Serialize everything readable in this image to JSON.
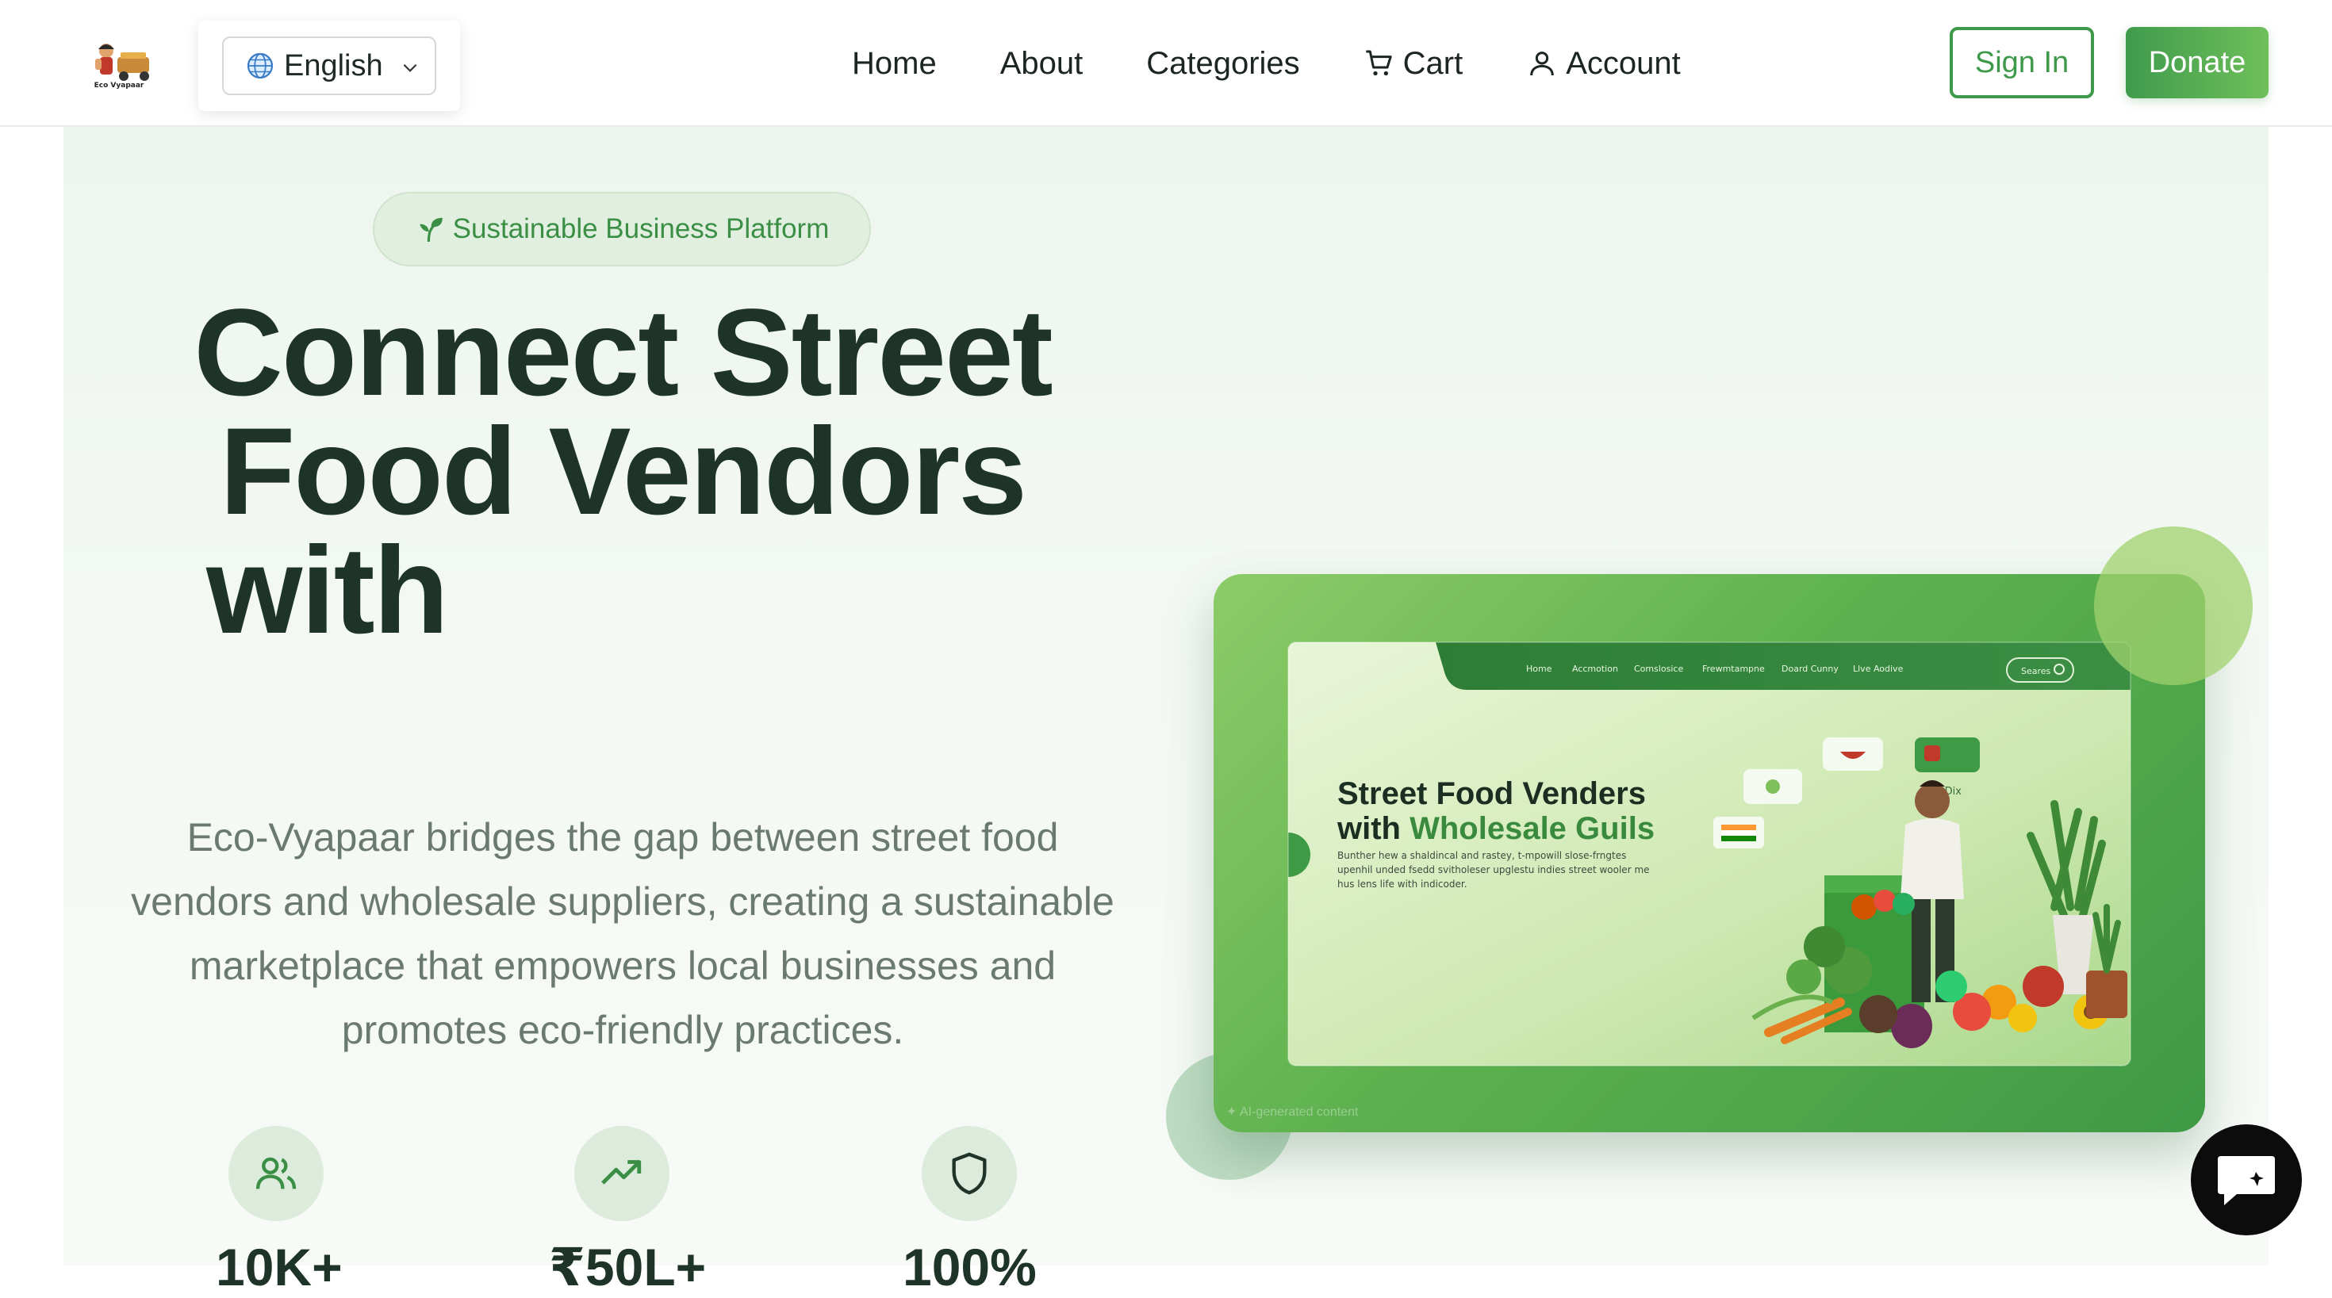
{
  "brand": {
    "logo_icon": "eco-vyapaar-logo"
  },
  "language": {
    "selected": "English",
    "globe_icon": "globe-icon",
    "chevron_icon": "chevron-down-icon"
  },
  "nav": {
    "links": [
      {
        "label": "Home"
      },
      {
        "label": "About"
      },
      {
        "label": "Categories"
      },
      {
        "label": "Cart",
        "icon": "cart-icon"
      },
      {
        "label": "Account",
        "icon": "user-icon"
      }
    ],
    "signin_label": "Sign In",
    "donate_label": "Donate"
  },
  "hero": {
    "badge": "Sustainable Business Platform",
    "badge_icon": "sprout-icon",
    "headline_lines": [
      "Connect Street",
      "Food Vendors",
      "with"
    ],
    "description": "Eco-Vyapaar bridges the gap between street food vendors and wholesale suppliers, creating a sustainable marketplace that empowers local businesses and promotes eco-friendly practices.",
    "stats": [
      {
        "icon": "users-icon",
        "value": "10K+"
      },
      {
        "icon": "trending-up-icon",
        "value": "₹50L+"
      },
      {
        "icon": "shield-icon",
        "value": "100%"
      }
    ]
  },
  "preview": {
    "nav_items": [
      "Home",
      "Accmotion",
      "Comslosice",
      "Frewmtampne",
      "Doard Cunny",
      "Llve Aodive"
    ],
    "search_label": "Seares",
    "title_line1": "Street Food Venders",
    "title_line2_prefix": "with ",
    "title_line2_highlight": "Wholesale Guils",
    "body": "Bunther hew a shaldincal and rastey, t-mpowill slose-frngtes upenhil unded fsedd svitholeser upglestu indies street wooler me hus lens life with indicoder.",
    "tag": "F Dix",
    "ai_note": "✦ AI-generated content"
  },
  "colors": {
    "brand_green": "#3e9a4a",
    "headline": "#1e3428",
    "body_text": "#6b7a70",
    "hero_bg": "#eef5ee"
  },
  "chat": {
    "icon": "chat-icon"
  }
}
